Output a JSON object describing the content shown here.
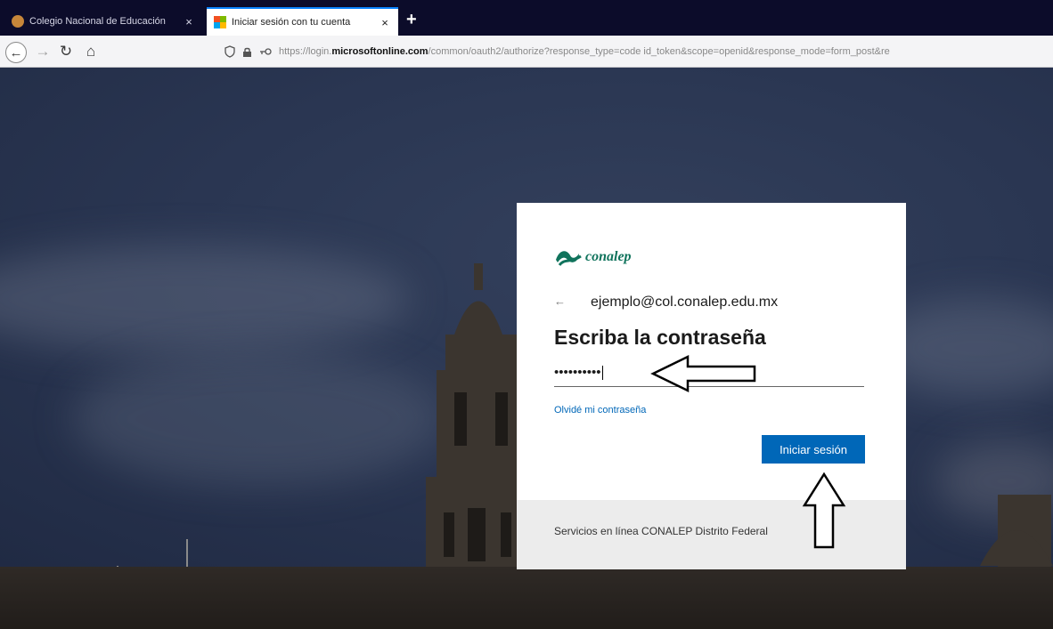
{
  "browser": {
    "tabs": [
      {
        "label": "Colegio Nacional de Educación",
        "close": "×",
        "active": false
      },
      {
        "label": "Iniciar sesión con tu cuenta",
        "close": "×",
        "active": true
      }
    ],
    "new_tab": "+",
    "nav": {
      "back": "←",
      "forward": "→",
      "reload": "↻",
      "home": "⌂"
    },
    "url": {
      "prefix": "https://login.",
      "host": "microsoftonline.com",
      "path": "/common/oauth2/authorize?response_type=code id_token&scope=openid&response_mode=form_post&re"
    }
  },
  "login": {
    "brand": "conalep",
    "back_arrow": "←",
    "email": "ejemplo@col.conalep.edu.mx",
    "heading": "Escriba la contraseña",
    "password_mask": "••••••••••",
    "forgot": "Olvidé mi contraseña",
    "signin": "Iniciar sesión",
    "footer": "Servicios en línea CONALEP Distrito Federal"
  },
  "colors": {
    "tabstrip": "#0c0c2a",
    "accent": "#0067b8",
    "brand_green": "#10735c"
  },
  "icons": [
    "shield-icon",
    "lock-icon",
    "key-icon",
    "back-arrow-icon",
    "reload-icon",
    "home-icon"
  ]
}
